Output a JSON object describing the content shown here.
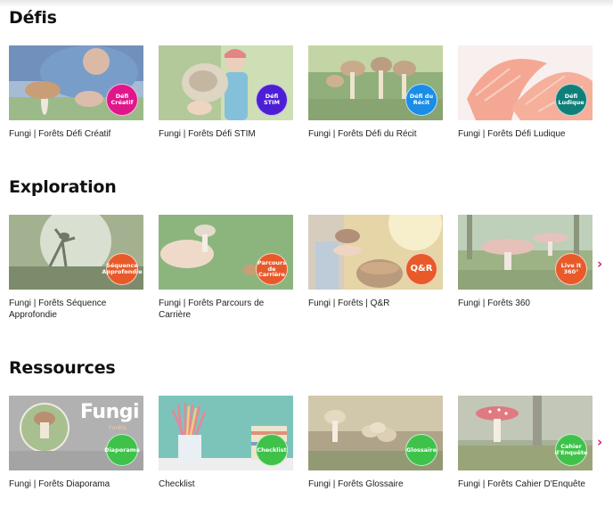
{
  "sections": [
    {
      "title": "Défis",
      "cards": [
        {
          "caption": "Fungi | Forêts Défi Créatif",
          "badge": "Défi Créatif",
          "badge_color": "#e0168a"
        },
        {
          "caption": "Fungi | Forêts Défi STIM",
          "badge": "Défi STIM",
          "badge_color": "#4d1fd4"
        },
        {
          "caption": "Fungi | Forêts Défi du Récit",
          "badge": "Défi du Récit",
          "badge_color": "#1a8de6"
        },
        {
          "caption": "Fungi | Forêts Défi Ludique",
          "badge": "Défi Ludique",
          "badge_color": "#0f7f7a"
        }
      ]
    },
    {
      "title": "Exploration",
      "cards": [
        {
          "caption": "Fungi | Forêts Séquence Approfondie",
          "badge": "Séquence Approfondie",
          "badge_color": "#e85a2a"
        },
        {
          "caption": "Fungi | Forêts Parcours de Carrière",
          "badge": "Parcours de Carrière",
          "badge_color": "#e85a2a"
        },
        {
          "caption": "Fungi | Forêts | Q&R",
          "badge": "Q&R",
          "badge_color": "#e85a2a"
        },
        {
          "caption": "Fungi | Forêts 360",
          "badge": "Live It 360°",
          "badge_color": "#e85a2a"
        }
      ]
    },
    {
      "title": "Ressources",
      "cards": [
        {
          "caption": "Fungi | Forêts Diaporama",
          "badge": "Diaporama",
          "badge_color": "#3fc24a"
        },
        {
          "caption": "Checklist",
          "badge": "Checklist",
          "badge_color": "#3fc24a"
        },
        {
          "caption": "Fungi | Forêts Glossaire",
          "badge": "Glossaire",
          "badge_color": "#3fc24a"
        },
        {
          "caption": "Fungi | Forêts Cahier D'Enquête",
          "badge": "Cahier d'Enquête",
          "badge_color": "#3fc24a"
        }
      ]
    }
  ],
  "diaporama_thumb": {
    "title": "Fungi",
    "subtitle": "Forêts"
  },
  "next_arrow_glyph": "›",
  "icons": {
    "next": "chevron-right-icon"
  }
}
